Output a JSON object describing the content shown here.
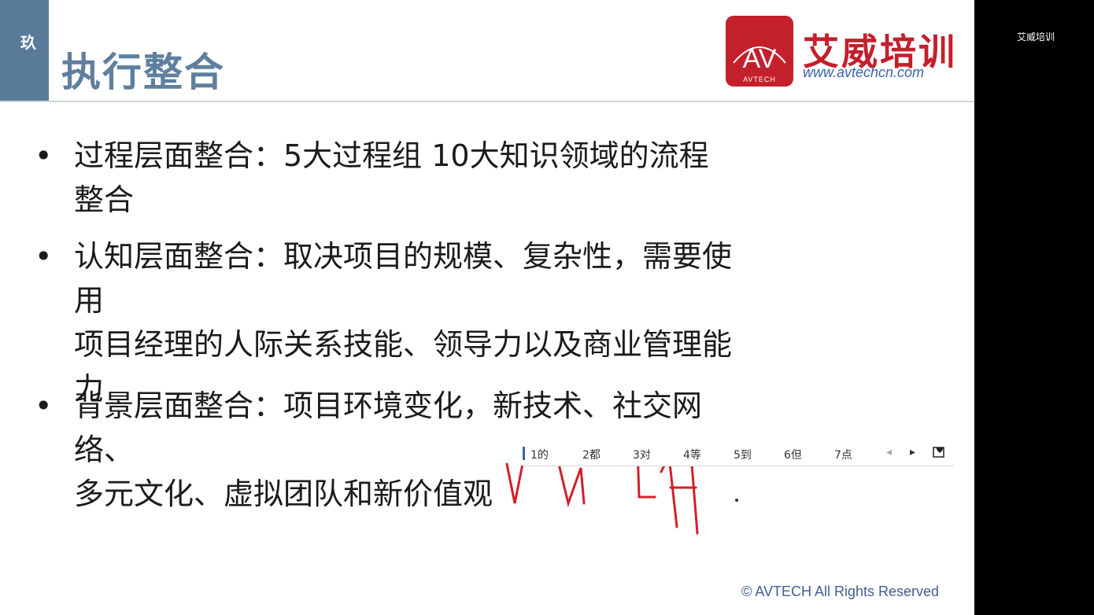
{
  "slide": {
    "tab_label": "玖",
    "title": "执行整合",
    "brand": {
      "logo_text": "AV",
      "logo_sub": "AVTECH",
      "name": "艾威培训",
      "url": "www.avtechcn.com",
      "color": "#c3202c"
    },
    "bullets": [
      {
        "marker": "•",
        "text": "过程层面整合：5大过程组 10大知识领域的流程整合"
      },
      {
        "marker": "•",
        "text": "认知层面整合：取决项目的规模、复杂性，需要使用\n项目经理的人际关系技能、领导力以及商业管理能力"
      },
      {
        "marker": "•",
        "text": "背景层面整合：项目环境变化，新技术、社交网络、\n多元文化、虚拟团队和新价值观"
      }
    ],
    "footer": "© AVTECH All Rights Reserved"
  },
  "ime": {
    "candidates": [
      "1的",
      "2都",
      "3对",
      "4等",
      "5到",
      "6但",
      "7点"
    ],
    "prev_icon": "chevron-left-icon",
    "next_icon": "chevron-right-icon",
    "extra_icon": "heart-icon"
  },
  "right_panel": {
    "label": "艾威培训"
  },
  "colors": {
    "title": "#5f7f9f",
    "accent_strip": "#5a7a99",
    "handwriting": "#d0202a"
  }
}
